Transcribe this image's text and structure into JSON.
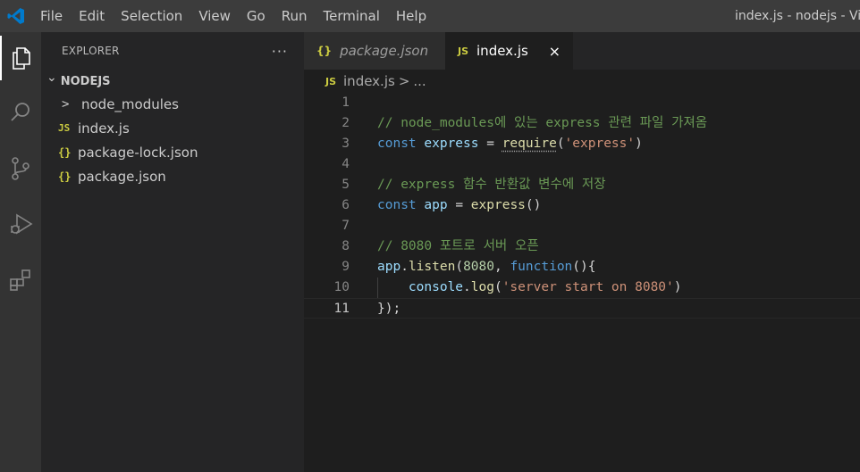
{
  "window": {
    "title": "index.js - nodejs - Vis",
    "menu": [
      "File",
      "Edit",
      "Selection",
      "View",
      "Go",
      "Run",
      "Terminal",
      "Help"
    ]
  },
  "colors": {
    "accent": "#007acc",
    "titlebar": "#3c3c3c",
    "activitybar": "#333333",
    "sidebar": "#252526",
    "editor": "#1e1e1e",
    "js_badge": "#cbcb41"
  },
  "activitybar": {
    "icons": [
      "explorer-icon",
      "search-icon",
      "source-control-icon",
      "run-debug-icon",
      "extensions-icon"
    ]
  },
  "sidebar": {
    "title": "EXPLORER",
    "more": "···",
    "folder": {
      "chevron": "⌄",
      "name": "NODEJS"
    },
    "items": [
      {
        "icon": ">",
        "name": "node_modules",
        "type": "folder"
      },
      {
        "icon": "JS",
        "name": "index.js",
        "type": "js"
      },
      {
        "icon": "{}",
        "name": "package-lock.json",
        "type": "json"
      },
      {
        "icon": "{}",
        "name": "package.json",
        "type": "json"
      }
    ]
  },
  "tabs": [
    {
      "icon": "{}",
      "label": "package.json",
      "active": false
    },
    {
      "icon": "JS",
      "label": "index.js",
      "active": true,
      "close": "×"
    }
  ],
  "breadcrumb": {
    "icon": "JS",
    "file": "index.js",
    "separator": ">",
    "more": "..."
  },
  "editor": {
    "current_line": 11,
    "lines": [
      {
        "no": "1",
        "tokens": []
      },
      {
        "no": "2",
        "tokens": [
          {
            "t": "comment",
            "v": "// node_modules에 있는 express 관련 파일 가져옴"
          }
        ]
      },
      {
        "no": "3",
        "tokens": [
          {
            "t": "keyword",
            "v": "const"
          },
          {
            "t": "plain",
            "v": " "
          },
          {
            "t": "var",
            "v": "express"
          },
          {
            "t": "plain",
            "v": " = "
          },
          {
            "t": "func-dotted",
            "v": "require"
          },
          {
            "t": "plain",
            "v": "("
          },
          {
            "t": "string",
            "v": "'express'"
          },
          {
            "t": "plain",
            "v": ")"
          }
        ]
      },
      {
        "no": "4",
        "tokens": []
      },
      {
        "no": "5",
        "tokens": [
          {
            "t": "comment",
            "v": "// express 함수 반환값 변수에 저장"
          }
        ]
      },
      {
        "no": "6",
        "tokens": [
          {
            "t": "keyword",
            "v": "const"
          },
          {
            "t": "plain",
            "v": " "
          },
          {
            "t": "var",
            "v": "app"
          },
          {
            "t": "plain",
            "v": " = "
          },
          {
            "t": "func",
            "v": "express"
          },
          {
            "t": "plain",
            "v": "()"
          }
        ]
      },
      {
        "no": "7",
        "tokens": []
      },
      {
        "no": "8",
        "tokens": [
          {
            "t": "comment",
            "v": "// 8080 포트로 서버 오픈"
          }
        ]
      },
      {
        "no": "9",
        "tokens": [
          {
            "t": "var",
            "v": "app"
          },
          {
            "t": "plain",
            "v": "."
          },
          {
            "t": "func",
            "v": "listen"
          },
          {
            "t": "plain",
            "v": "("
          },
          {
            "t": "num",
            "v": "8080"
          },
          {
            "t": "plain",
            "v": ", "
          },
          {
            "t": "keyword",
            "v": "function"
          },
          {
            "t": "plain",
            "v": "(){"
          }
        ]
      },
      {
        "no": "10",
        "tokens": [
          {
            "t": "plain",
            "v": "    "
          },
          {
            "t": "var",
            "v": "console"
          },
          {
            "t": "plain",
            "v": "."
          },
          {
            "t": "func",
            "v": "log"
          },
          {
            "t": "plain",
            "v": "("
          },
          {
            "t": "string",
            "v": "'server start on 8080'"
          },
          {
            "t": "plain",
            "v": ")"
          }
        ]
      },
      {
        "no": "11",
        "tokens": [
          {
            "t": "plain",
            "v": "});"
          }
        ]
      }
    ]
  }
}
